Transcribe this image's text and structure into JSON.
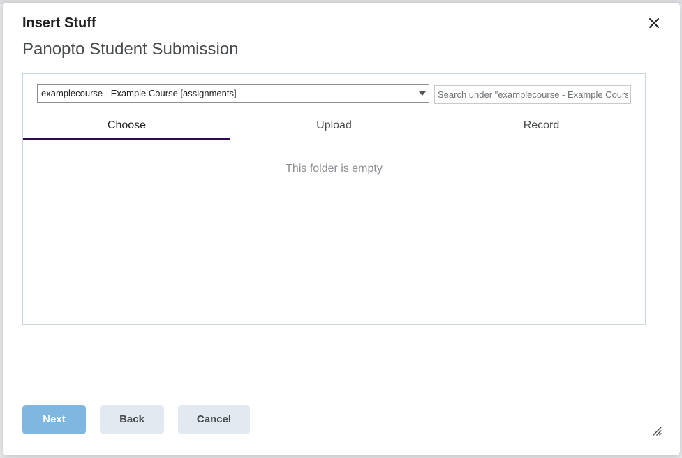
{
  "dialog": {
    "title": "Insert Stuff",
    "subtitle": "Panopto Student Submission"
  },
  "folder_select": {
    "selected": "examplecourse - Example Course [assignments]"
  },
  "search": {
    "placeholder": "Search under \"examplecourse - Example Course [assignments]\""
  },
  "tabs": [
    {
      "label": "Choose",
      "active": true
    },
    {
      "label": "Upload",
      "active": false
    },
    {
      "label": "Record",
      "active": false
    }
  ],
  "content": {
    "empty_message": "This folder is empty"
  },
  "buttons": {
    "next": "Next",
    "back": "Back",
    "cancel": "Cancel"
  },
  "colors": {
    "active_tab_underline": "#2b0b52",
    "primary_button": "#80b7e0",
    "secondary_button": "#e3e9f1"
  },
  "icons": {
    "close": "close-icon",
    "dropdown": "chevron-down-icon",
    "resize": "resize-handle-icon"
  }
}
